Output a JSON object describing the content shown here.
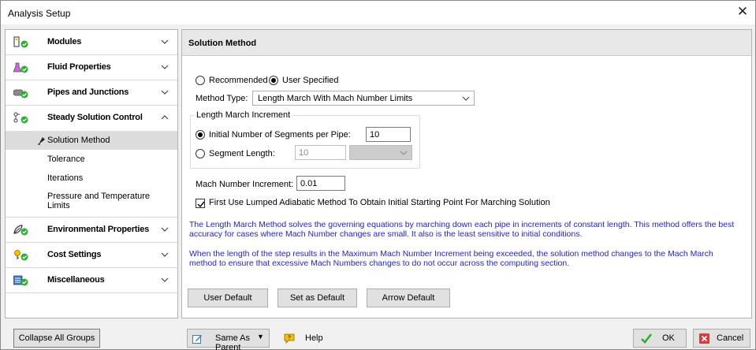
{
  "window": {
    "title": "Analysis Setup",
    "close_glyph": "✕"
  },
  "sidebar": {
    "groups": [
      {
        "label": "Modules",
        "icon": "modules-icon",
        "expanded": false
      },
      {
        "label": "Fluid Properties",
        "icon": "fluid-properties-icon",
        "expanded": false
      },
      {
        "label": "Pipes and Junctions",
        "icon": "pipes-junctions-icon",
        "expanded": false
      },
      {
        "label": "Steady Solution Control",
        "icon": "steady-solution-icon",
        "expanded": true,
        "items": [
          "Solution Method",
          "Tolerance",
          "Iterations",
          "Pressure and Temperature Limits"
        ],
        "selected": "Solution Method"
      },
      {
        "label": "Environmental Properties",
        "icon": "environmental-icon",
        "expanded": false
      },
      {
        "label": "Cost Settings",
        "icon": "cost-settings-icon",
        "expanded": false
      },
      {
        "label": "Miscellaneous",
        "icon": "miscellaneous-icon",
        "expanded": false
      }
    ]
  },
  "panel": {
    "title": "Solution Method",
    "mode": {
      "recommended": "Recommended",
      "user_specified": "User Specified",
      "selected": "user_specified"
    },
    "method_type": {
      "label": "Method Type:",
      "value": "Length March With Mach Number Limits"
    },
    "length_march": {
      "legend": "Length March Increment",
      "initial_segments_label": "Initial Number of Segments per Pipe:",
      "initial_segments_value": "10",
      "segment_length_label": "Segment Length:",
      "segment_length_value": "10",
      "selected": "initial_segments"
    },
    "mach_increment": {
      "label": "Mach Number Increment:",
      "value": "0.01"
    },
    "lumped_checkbox": {
      "label": "First Use Lumped Adiabatic Method To Obtain Initial Starting Point For Marching Solution",
      "checked": true
    },
    "description": [
      "The Length March Method solves the governing equations by marching down each pipe in increments of constant length. This method offers the best",
      "accuracy for cases where Mach Number changes are small. It also is the least sensitive to initial conditions.",
      "When the length of the step results in the Maximum Mach Number Increment being exceeded, the solution method changes to the Mach March",
      "method to ensure that excessive Mach Numbers changes to do not occur across the computing section."
    ],
    "buttons": {
      "user_default": "User Default",
      "set_default": "Set as Default",
      "arrow_default": "Arrow Default"
    }
  },
  "footer": {
    "collapse_all": "Collapse All Groups",
    "same_as_parent": "Same As Parent",
    "help": "Help",
    "ok": "OK",
    "cancel": "Cancel"
  },
  "colors": {
    "description_text": "#2222dd",
    "accent_green": "#2eae2e",
    "cancel_red": "#d83b3b"
  }
}
